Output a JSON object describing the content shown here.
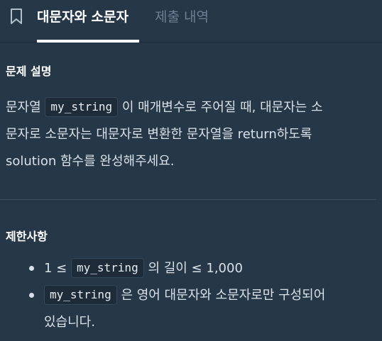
{
  "tabs": {
    "active": "대문자와 소문자",
    "inactive": "제출 내역"
  },
  "description": {
    "title": "문제 설명",
    "line1_pre": "문자열",
    "code_var": "my_string",
    "line1_post": "이 매개변수로 주어질 때, 대문자는 소",
    "line2": "문자로 소문자는 대문자로 변환한 문자열을 return하도록",
    "line3": "solution 함수를 완성해주세요."
  },
  "constraints": {
    "title": "제한사항",
    "item1_pre": "1 ≤",
    "item1_code": "my_string",
    "item1_post": "의 길이 ≤ 1,000",
    "item2_code": "my_string",
    "item2_post": "은 영어 대문자와 소문자로만 구성되어",
    "item2_line2": "있습니다."
  }
}
